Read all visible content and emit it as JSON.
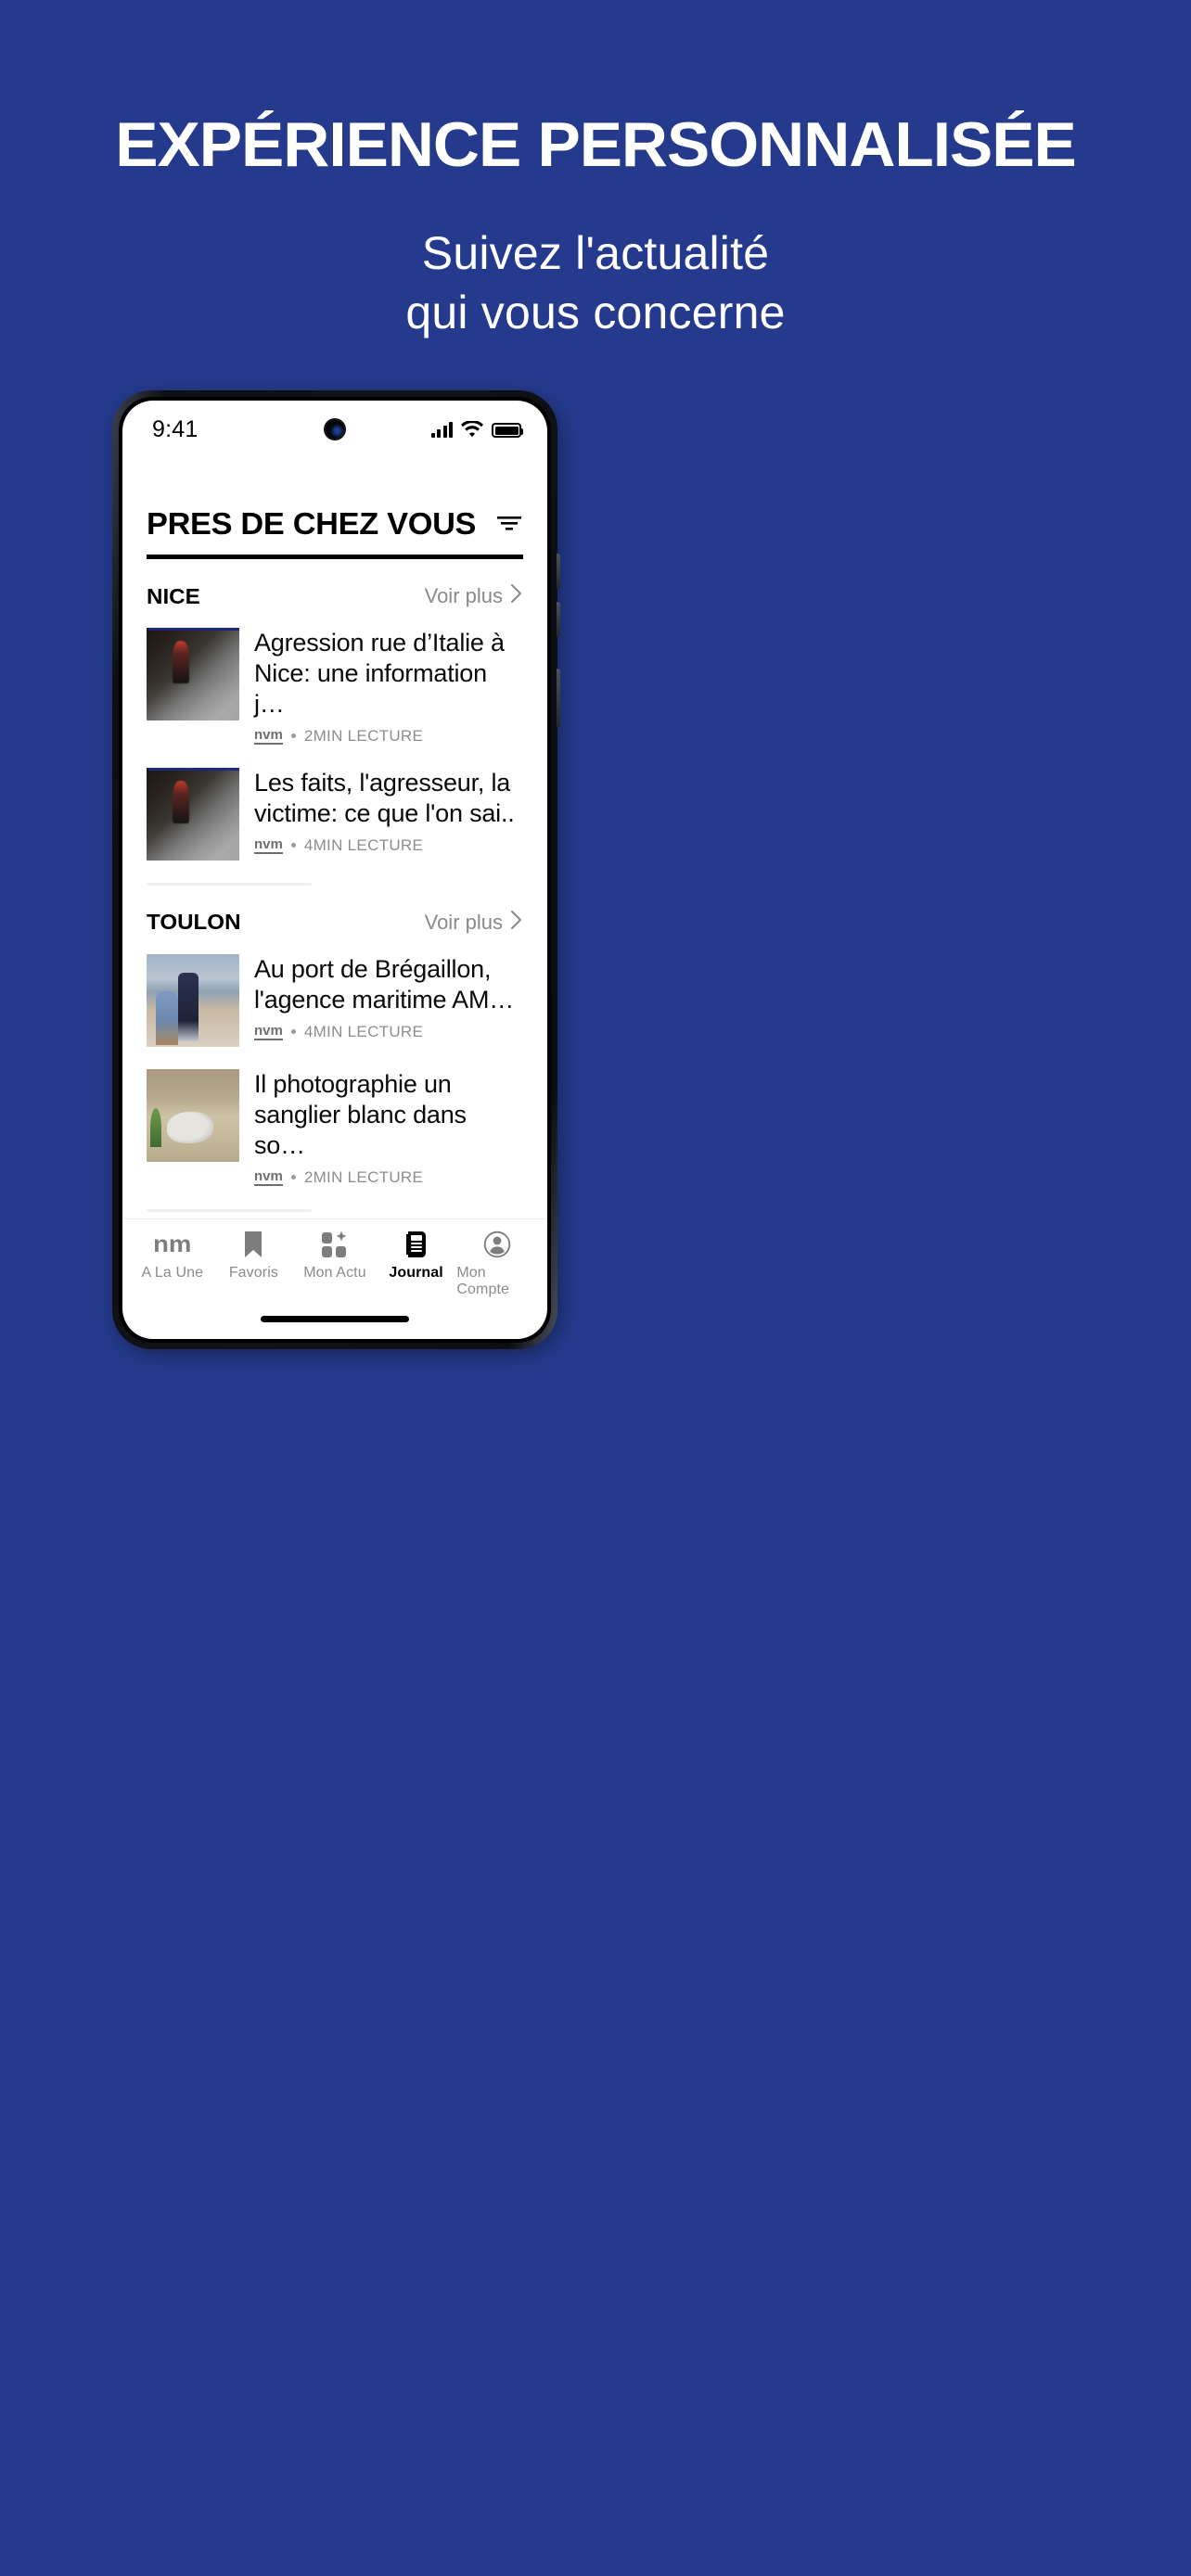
{
  "promo": {
    "title": "EXPÉRIENCE PERSONNALISÉE",
    "subtitle_line1": "Suivez l'actualité",
    "subtitle_line2": "qui vous concerne",
    "background_color": "#253A8C",
    "text_color": "#FFFFFF"
  },
  "status_bar": {
    "time": "9:41",
    "signal_icon": "cellular-signal-icon",
    "wifi_icon": "wifi-icon",
    "battery_icon": "battery-full-icon"
  },
  "app": {
    "header": {
      "title": "PRES DE CHEZ VOUS",
      "filter_icon": "filter-icon"
    },
    "sections": [
      {
        "city": "NICE",
        "see_more_label": "Voir plus",
        "see_more_icon": "chevron-right-icon",
        "articles": [
          {
            "title": "Agression rue d’Italie à Nice: une information j…",
            "source": "nvm",
            "read_time": "2MIN LECTURE",
            "thumb_class": "t-night"
          },
          {
            "title": "Les faits, l'agresseur, la victime: ce que l'on sai..",
            "source": "nvm",
            "read_time": "4MIN LECTURE",
            "thumb_class": "t-night"
          }
        ]
      },
      {
        "city": "TOULON",
        "see_more_label": "Voir plus",
        "see_more_icon": "chevron-right-icon",
        "articles": [
          {
            "title": "Au port de Brégaillon, l'agence maritime AM…",
            "source": "nvm",
            "read_time": "4MIN LECTURE",
            "thumb_class": "t-group"
          },
          {
            "title": "Il photographie un sanglier blanc dans so…",
            "source": "nvm",
            "read_time": "2MIN LECTURE",
            "thumb_class": "t-boar"
          }
        ]
      }
    ],
    "tabbar": {
      "items": [
        {
          "label": "A La Une",
          "icon": "nm-logo-icon",
          "active": false,
          "logo_text": "nm"
        },
        {
          "label": "Favoris",
          "icon": "bookmark-icon",
          "active": false
        },
        {
          "label": "Mon Actu",
          "icon": "sparkle-tiles-icon",
          "active": false
        },
        {
          "label": "Journal",
          "icon": "newspaper-icon",
          "active": true
        },
        {
          "label": "Mon Compte",
          "icon": "account-circle-icon",
          "active": false
        }
      ]
    }
  }
}
